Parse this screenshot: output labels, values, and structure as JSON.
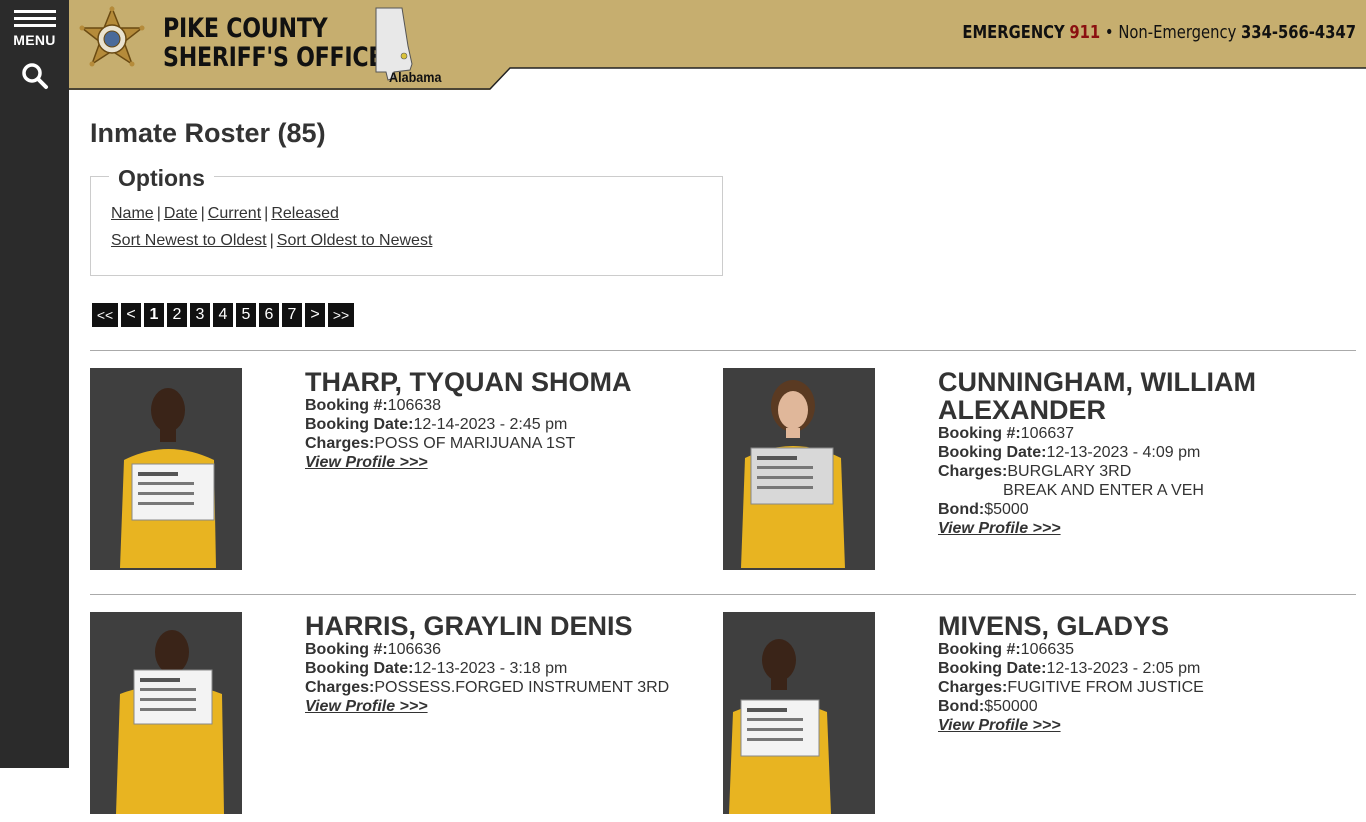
{
  "sidebar": {
    "menu_label": "MENU"
  },
  "header": {
    "org_line1": "PIKE COUNTY",
    "org_line2": "SHERIFF'S OFFICE",
    "state_label": "Alabama",
    "emergency_label": "EMERGENCY",
    "emergency_number": "911",
    "separator": "•",
    "non_emergency_label": "Non-Emergency",
    "non_emergency_number": "334-566-4347"
  },
  "page": {
    "title": "Inmate Roster (85)"
  },
  "options": {
    "legend": "Options",
    "filters": [
      "Name",
      "Date",
      "Current",
      "Released"
    ],
    "sorts": [
      "Sort Newest to Oldest",
      "Sort Oldest to Newest"
    ],
    "divider": "|"
  },
  "pagination": {
    "first": "<<",
    "prev": "<",
    "pages": [
      "1",
      "2",
      "3",
      "4",
      "5",
      "6",
      "7"
    ],
    "current": "1",
    "next": ">",
    "last": ">>"
  },
  "labels": {
    "booking": "Booking #:",
    "booking_date": "Booking Date:",
    "charges": "Charges:",
    "bond": "Bond:",
    "view_profile": "View Profile >>>"
  },
  "inmates": [
    {
      "name": "THARP, TYQUAN SHOMA",
      "booking": "106638",
      "booking_date": "12-14-2023 - 2:45 pm",
      "charges": [
        "POSS OF MARIJUANA 1ST"
      ],
      "bond": ""
    },
    {
      "name": "CUNNINGHAM, WILLIAM ALEXANDER",
      "booking": "106637",
      "booking_date": "12-13-2023 - 4:09 pm",
      "charges": [
        "BURGLARY 3RD",
        "BREAK AND ENTER A VEH"
      ],
      "bond": "$5000"
    },
    {
      "name": "HARRIS, GRAYLIN DENIS",
      "booking": "106636",
      "booking_date": "12-13-2023 - 3:18 pm",
      "charges": [
        "POSSESS.FORGED INSTRUMENT 3RD"
      ],
      "bond": ""
    },
    {
      "name": "MIVENS, GLADYS",
      "booking": "106635",
      "booking_date": "12-13-2023 - 2:05 pm",
      "charges": [
        "FUGITIVE FROM JUSTICE"
      ],
      "bond": "$50000"
    }
  ],
  "colors": {
    "header_gold": "#c6ae6f",
    "sidebar": "#2b2b2b",
    "emergency_red": "#8b1010",
    "pager_bg": "#111111"
  }
}
